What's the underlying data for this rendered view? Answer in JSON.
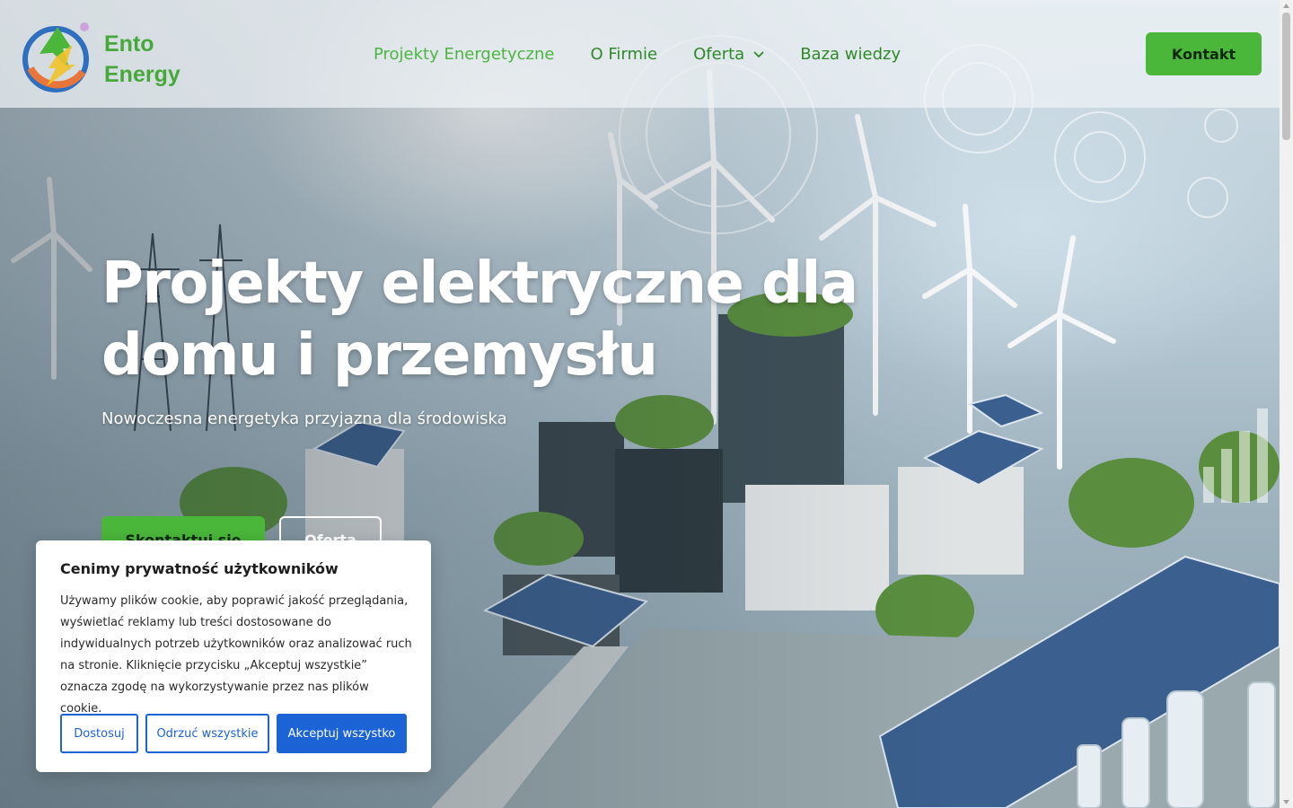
{
  "brand": {
    "line1": "Ento",
    "line2": "Energy",
    "color": "#46a83a"
  },
  "nav": {
    "items": [
      {
        "label": "Projekty Energetyczne",
        "active": true
      },
      {
        "label": "O Firmie"
      },
      {
        "label": "Oferta",
        "has_dropdown": true,
        "icon": "chevron-down-icon"
      },
      {
        "label": "Baza wiedzy"
      }
    ]
  },
  "header": {
    "contact_label": "Kontakt"
  },
  "hero": {
    "title_line1": "Projekty elektryczne dla",
    "title_line2": "domu i przemysłu",
    "subtitle": "Nowoczesna energetyka przyjazna dla środowiska",
    "primary_cta": "Skontaktuj się",
    "secondary_cta": "Oferta"
  },
  "cookie": {
    "title": "Cenimy prywatność użytkowników",
    "body": "Używamy plików cookie, aby poprawić jakość przeglądania, wyświetlać reklamy lub treści dostosowane do indywidualnych potrzeb użytkowników oraz analizować ruch na stronie. Kliknięcie przycisku „Akceptuj wszystkie” oznacza zgodę na wykorzystywanie przez nas plików cookie.",
    "customize": "Dostosuj",
    "reject": "Odrzuć wszystkie",
    "accept": "Akceptuj wszystko"
  },
  "colors": {
    "accent_green": "#4ab63a",
    "cookie_blue": "#1c63d6"
  }
}
